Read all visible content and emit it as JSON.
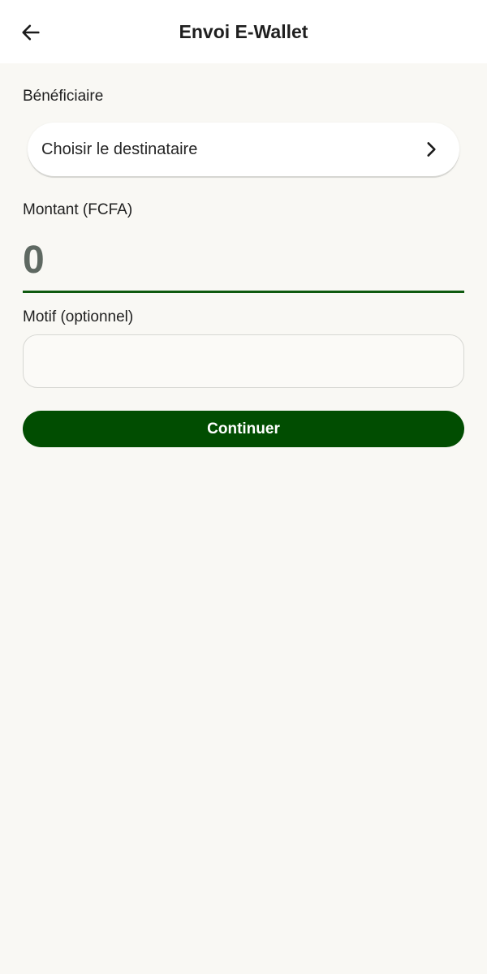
{
  "header": {
    "title": "Envoi E-Wallet",
    "back_icon": "arrow-left-icon"
  },
  "beneficiary": {
    "label": "Bénéficiaire",
    "placeholder": "Choisir le destinataire",
    "chevron_icon": "chevron-right-icon"
  },
  "amount": {
    "label": "Montant (FCFA)",
    "value": "0"
  },
  "motif": {
    "label": "Motif (optionnel)",
    "value": ""
  },
  "actions": {
    "continue_label": "Continuer"
  },
  "colors": {
    "background": "#f9f8f4",
    "header_background": "#ffffff",
    "primary": "#014d01",
    "amount_underline": "#0f5a0f",
    "amount_text": "#5f6962"
  }
}
